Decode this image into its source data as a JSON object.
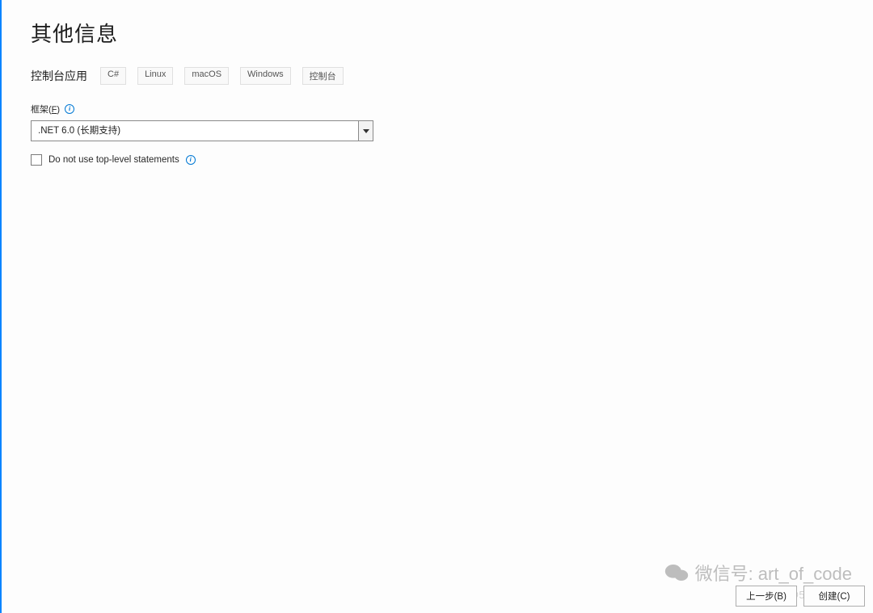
{
  "title": "其他信息",
  "project": {
    "type_label": "控制台应用",
    "tags": [
      "C#",
      "Linux",
      "macOS",
      "Windows",
      "控制台"
    ]
  },
  "framework": {
    "label_prefix": "框架(",
    "label_key": "F",
    "label_suffix": ")",
    "selected": ".NET 6.0 (长期支持)"
  },
  "checkbox_toplevel": {
    "checked": false,
    "label": "Do not use top-level statements"
  },
  "footer": {
    "back": "上一步(B)",
    "create": "创建(C)"
  },
  "watermark": {
    "line1": "微信号: art_of_code",
    "line2": "@51CTO博客"
  }
}
